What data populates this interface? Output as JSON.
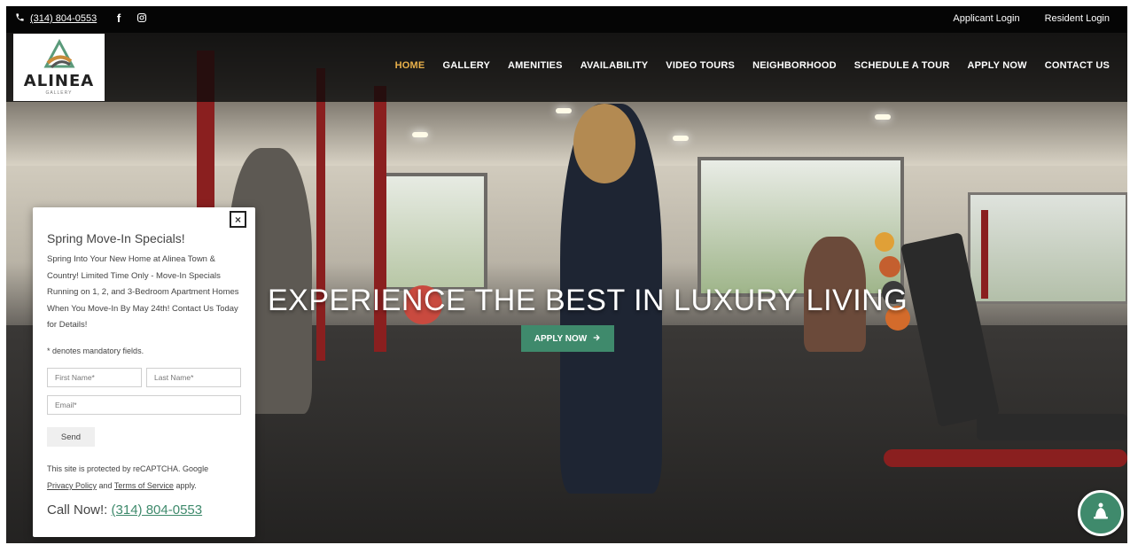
{
  "topbar": {
    "phone": "(314) 804-0553",
    "applicant_login": "Applicant Login",
    "resident_login": "Resident Login"
  },
  "logo": {
    "wordmark": "ALINEA",
    "sub": "GALLERY"
  },
  "nav": {
    "items": [
      "HOME",
      "GALLERY",
      "AMENITIES",
      "AVAILABILITY",
      "VIDEO TOURS",
      "NEIGHBORHOOD",
      "SCHEDULE A TOUR",
      "APPLY NOW",
      "CONTACT US"
    ],
    "active": "HOME"
  },
  "hero": {
    "headline": "EXPERIENCE THE BEST IN LUXURY LIVING",
    "cta": "APPLY NOW"
  },
  "popup": {
    "title": "Spring Move-In Specials!",
    "body": "Spring Into Your New Home at Alinea Town & Country! Limited Time Only - Move-In Specials Running on 1, 2, and 3-Bedroom Apartment Homes When You Move-In By May 24th! Contact Us Today for Details!",
    "note": "* denotes mandatory fields.",
    "first_name_placeholder": "First Name*",
    "last_name_placeholder": "Last Name*",
    "email_placeholder": "Email*",
    "send_label": "Send",
    "legal_prefix": "This site is protected by reCAPTCHA. Google",
    "privacy_policy": "Privacy Policy",
    "legal_and": "and",
    "terms_of_service": "Terms of Service",
    "legal_suffix": "apply.",
    "call_label": "Call Now!:",
    "call_phone": "(314) 804-0553"
  },
  "colors": {
    "accent_green": "#3f8a6c",
    "nav_active": "#e8b04a"
  },
  "icons": [
    "phone-icon",
    "facebook-icon",
    "instagram-icon",
    "close-icon",
    "arrow-right-icon",
    "chat-icon"
  ]
}
